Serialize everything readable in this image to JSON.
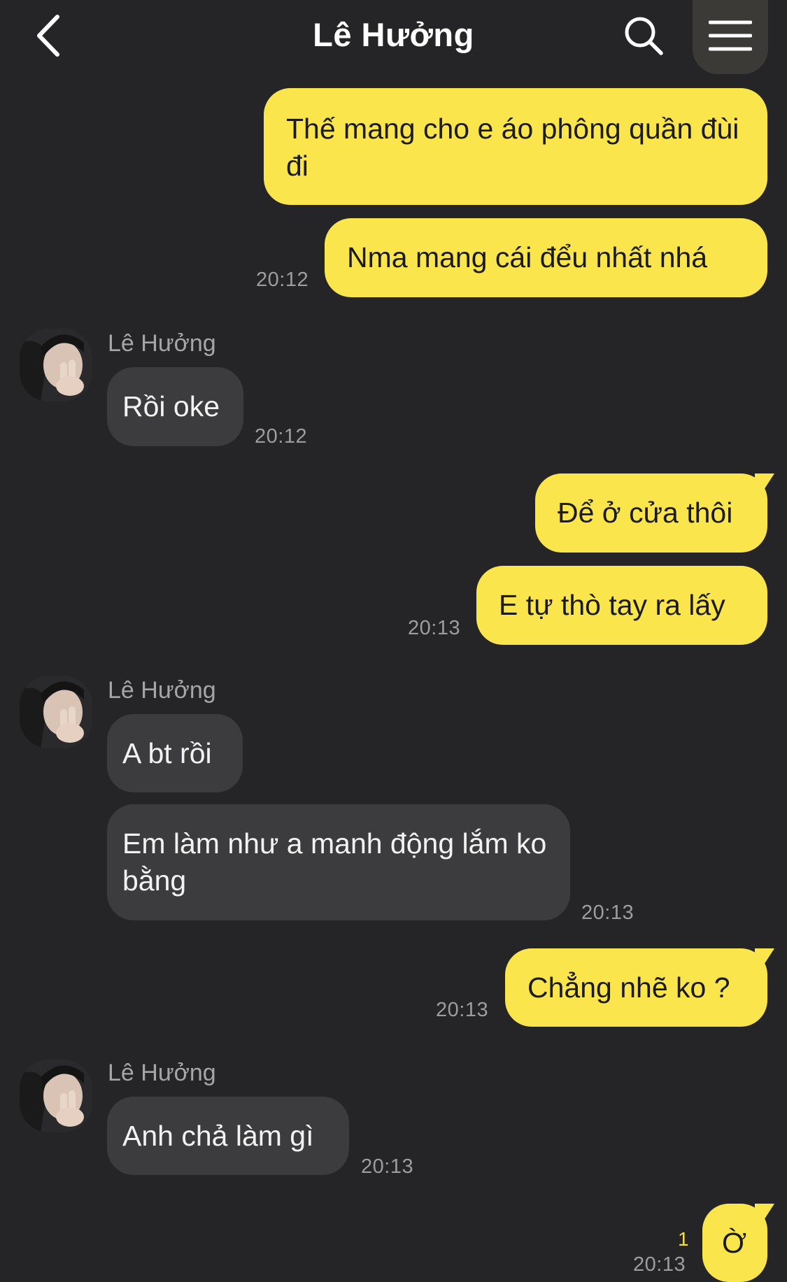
{
  "header": {
    "title": "Lê Hưởng",
    "back_icon": "chevron-left-icon",
    "search_icon": "search-icon",
    "menu_icon": "hamburger-menu-icon"
  },
  "colors": {
    "background": "#252528",
    "outgoing_bubble": "#fae64c",
    "incoming_bubble": "#3c3c3f",
    "unread": "#f5df3f"
  },
  "messages": [
    {
      "dir": "out",
      "text": "Thế mang cho e áo phông quần đùi đi"
    },
    {
      "dir": "out",
      "text": "Nma mang cái đểu nhất nhá",
      "time": "20:12"
    },
    {
      "dir": "in",
      "sender": "Lê Hưởng",
      "text": "Rồi oke",
      "time": "20:12"
    },
    {
      "dir": "out",
      "text": "Để ở cửa thôi"
    },
    {
      "dir": "out",
      "text": "E tự thò tay ra lấy",
      "time": "20:13"
    },
    {
      "dir": "in",
      "sender": "Lê Hưởng",
      "text": "A bt rồi"
    },
    {
      "dir": "in",
      "text": "Em làm như a manh động lắm ko bằng",
      "time": "20:13"
    },
    {
      "dir": "out",
      "text": "Chẳng nhẽ ko ?",
      "time": "20:13"
    },
    {
      "dir": "in",
      "sender": "Lê Hưởng",
      "text": "Anh chả làm gì",
      "time": "20:13"
    },
    {
      "dir": "out",
      "text": "Ờ",
      "time": "20:13",
      "unread": "1"
    }
  ]
}
